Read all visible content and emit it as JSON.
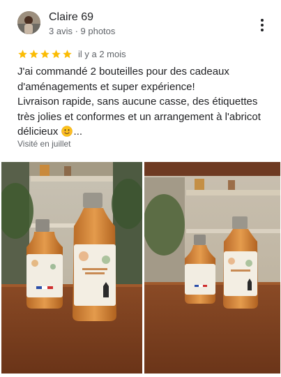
{
  "review": {
    "author": {
      "name": "Claire 69",
      "meta": "3 avis · 9 photos"
    },
    "rating": 5,
    "date": "il y a 2 mois",
    "text_lines": [
      "J'ai commandé 2 bouteilles pour des cadeaux",
      "d'aménagements et super expérience!",
      "Livraison rapide, sans aucune casse, des étiquettes",
      "très jolies et conformes et un arrangement à l'abricot"
    ],
    "text_last_line": "délicieux",
    "text_ellipsis": "...",
    "visited": "Visité en juillet"
  },
  "colors": {
    "star": "#fbbc04",
    "text": "#202124",
    "secondary": "#5f6368",
    "table_wood": "#7a4020",
    "bottle_liquid": "#d8893a"
  },
  "icons": {
    "more": "more-vert-icon",
    "star": "star-icon",
    "emoji": "smiling-face-emoji"
  }
}
